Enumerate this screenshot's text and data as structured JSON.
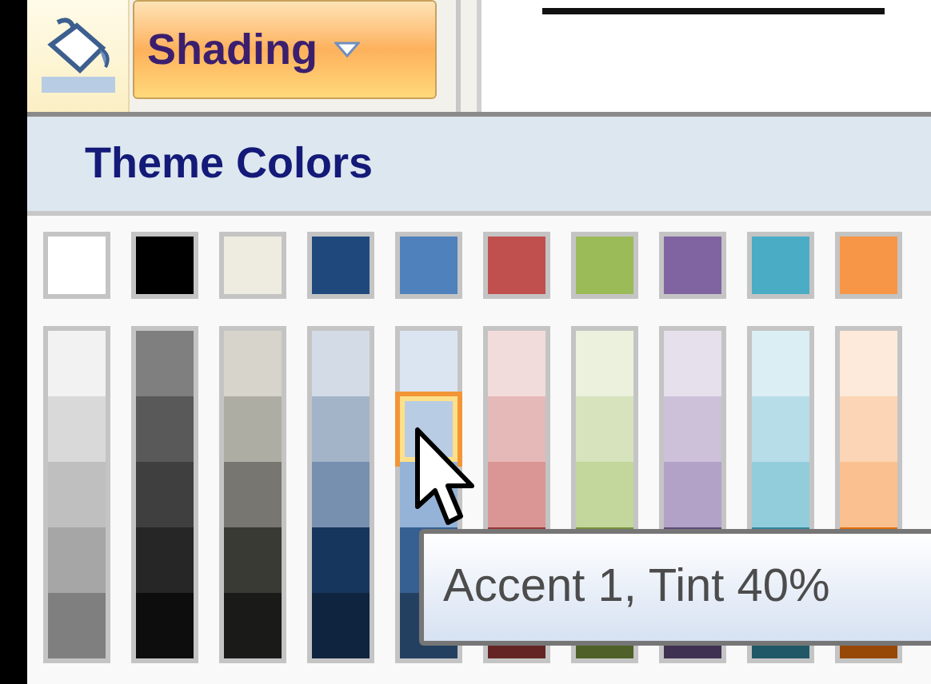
{
  "toolbar": {
    "button": {
      "label": "Shading"
    }
  },
  "panel": {
    "header": "Theme Colors",
    "columns": [
      {
        "base": {
          "color": "#ffffff",
          "selected": false
        },
        "tints": [
          {
            "color": "#f2f2f2",
            "selected": false
          },
          {
            "color": "#d9d9d9",
            "selected": false
          },
          {
            "color": "#bfbfbf",
            "selected": false
          },
          {
            "color": "#a6a6a6",
            "selected": false
          },
          {
            "color": "#7f7f7f",
            "selected": false
          }
        ]
      },
      {
        "base": {
          "color": "#000000",
          "selected": false
        },
        "tints": [
          {
            "color": "#7f7f7f",
            "selected": false
          },
          {
            "color": "#595959",
            "selected": false
          },
          {
            "color": "#3f3f3f",
            "selected": false
          },
          {
            "color": "#262626",
            "selected": false
          },
          {
            "color": "#0d0d0d",
            "selected": false
          }
        ]
      },
      {
        "base": {
          "color": "#eeece1",
          "selected": false
        },
        "tints": [
          {
            "color": "#d6d4cb",
            "selected": false
          },
          {
            "color": "#aeada4",
            "selected": false
          },
          {
            "color": "#777670",
            "selected": false
          },
          {
            "color": "#3a3a35",
            "selected": false
          },
          {
            "color": "#1a1a18",
            "selected": false
          }
        ]
      },
      {
        "base": {
          "color": "#1f497d",
          "selected": false
        },
        "tints": [
          {
            "color": "#d3dbe6",
            "selected": false
          },
          {
            "color": "#a3b4c8",
            "selected": false
          },
          {
            "color": "#7890b0",
            "selected": false
          },
          {
            "color": "#17365d",
            "selected": false
          },
          {
            "color": "#0f243e",
            "selected": false
          }
        ]
      },
      {
        "base": {
          "color": "#4f81bd",
          "selected": false
        },
        "tints": [
          {
            "color": "#dbe5f1",
            "selected": false
          },
          {
            "color": "#b8cce4",
            "selected": true
          },
          {
            "color": "#95b3d7",
            "selected": false
          },
          {
            "color": "#366092",
            "selected": false
          },
          {
            "color": "#244061",
            "selected": false
          }
        ]
      },
      {
        "base": {
          "color": "#c0504d",
          "selected": false
        },
        "tints": [
          {
            "color": "#f2dcdb",
            "selected": false
          },
          {
            "color": "#e5b9b7",
            "selected": false
          },
          {
            "color": "#d99694",
            "selected": false
          },
          {
            "color": "#953734",
            "selected": false
          },
          {
            "color": "#632423",
            "selected": false
          }
        ]
      },
      {
        "base": {
          "color": "#9bbb59",
          "selected": false
        },
        "tints": [
          {
            "color": "#ebf1dd",
            "selected": false
          },
          {
            "color": "#d7e3bc",
            "selected": false
          },
          {
            "color": "#c3d69b",
            "selected": false
          },
          {
            "color": "#76923c",
            "selected": false
          },
          {
            "color": "#4f6128",
            "selected": false
          }
        ]
      },
      {
        "base": {
          "color": "#8064a2",
          "selected": false
        },
        "tints": [
          {
            "color": "#e5e0ec",
            "selected": false
          },
          {
            "color": "#ccc1d9",
            "selected": false
          },
          {
            "color": "#b2a2c7",
            "selected": false
          },
          {
            "color": "#5f497a",
            "selected": false
          },
          {
            "color": "#3f3151",
            "selected": false
          }
        ]
      },
      {
        "base": {
          "color": "#4bacc6",
          "selected": false
        },
        "tints": [
          {
            "color": "#dbeef3",
            "selected": false
          },
          {
            "color": "#b7dde8",
            "selected": false
          },
          {
            "color": "#92cddc",
            "selected": false
          },
          {
            "color": "#31859b",
            "selected": false
          },
          {
            "color": "#205867",
            "selected": false
          }
        ]
      },
      {
        "base": {
          "color": "#f79646",
          "selected": false
        },
        "tints": [
          {
            "color": "#fdeada",
            "selected": false
          },
          {
            "color": "#fbd5b5",
            "selected": false
          },
          {
            "color": "#fac08f",
            "selected": false
          },
          {
            "color": "#e36c09",
            "selected": false
          },
          {
            "color": "#974806",
            "selected": false
          }
        ]
      }
    ]
  },
  "tooltip": {
    "text": "Accent 1, Tint 40%"
  }
}
